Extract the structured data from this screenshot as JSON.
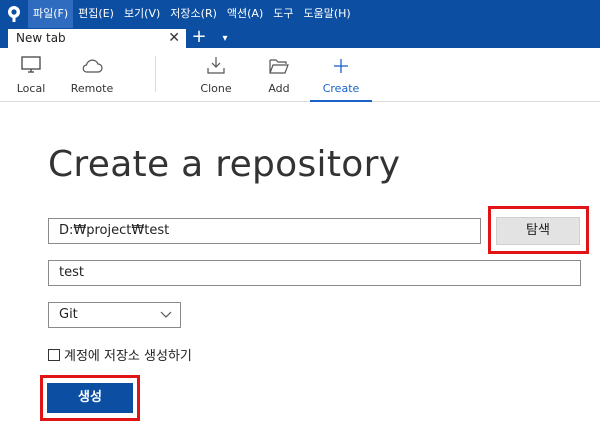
{
  "menubar": {
    "logo_icon": "sourcetree-logo-icon",
    "items": [
      {
        "label": "파일(F)"
      },
      {
        "label": "편집(E)"
      },
      {
        "label": "보기(V)"
      },
      {
        "label": "저장소(R)"
      },
      {
        "label": "액션(A)"
      },
      {
        "label": "도구"
      },
      {
        "label": "도움말(H)"
      }
    ]
  },
  "tabs": {
    "active_tab": "New tab",
    "close_glyph": "✕",
    "add_glyph": "+",
    "menu_glyph": "▾"
  },
  "toolbar": {
    "local": "Local",
    "remote": "Remote",
    "clone": "Clone",
    "add": "Add",
    "create": "Create",
    "active": "Create"
  },
  "form": {
    "title": "Create a repository",
    "path_value": "D:₩project₩test",
    "browse_label": "탐색",
    "name_value": "test",
    "vcs_type": "Git",
    "account_checkbox_label": "계정에 저장소 생성하기",
    "account_checkbox_checked": false,
    "create_label": "생성"
  },
  "colors": {
    "brand_blue": "#0b4ea2",
    "active_blue": "#1a63c6",
    "highlight_red": "#e01414"
  }
}
